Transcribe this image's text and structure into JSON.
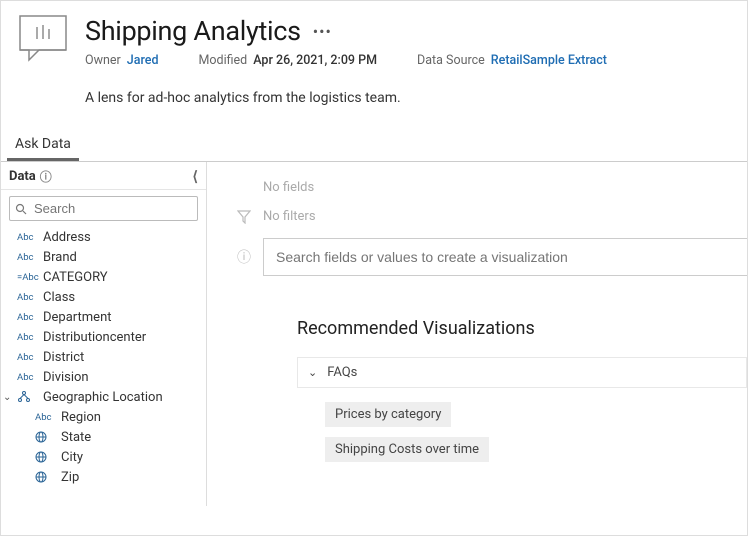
{
  "header": {
    "title": "Shipping Analytics",
    "owner_label": "Owner",
    "owner_name": "Jared",
    "modified_label": "Modified",
    "modified_value": "Apr 26, 2021, 2:09 PM",
    "datasource_label": "Data Source",
    "datasource_name": "RetailSample Extract",
    "description": "A lens for ad-hoc analytics from the logistics team."
  },
  "tab": {
    "label": "Ask Data"
  },
  "sidebar": {
    "data_label": "Data",
    "search_placeholder": "Search",
    "fields": [
      {
        "type": "Abc",
        "label": "Address"
      },
      {
        "type": "Abc",
        "label": "Brand"
      },
      {
        "type": "=Abc",
        "label": "CATEGORY"
      },
      {
        "type": "Abc",
        "label": "Class"
      },
      {
        "type": "Abc",
        "label": "Department"
      },
      {
        "type": "Abc",
        "label": "Distributioncenter"
      },
      {
        "type": "Abc",
        "label": "District"
      },
      {
        "type": "Abc",
        "label": "Division"
      }
    ],
    "geo": {
      "label": "Geographic Location",
      "children": [
        {
          "type": "Abc",
          "label": "Region"
        },
        {
          "type": "globe",
          "label": "State"
        },
        {
          "type": "globe",
          "label": "City"
        },
        {
          "type": "globe",
          "label": "Zip"
        }
      ]
    }
  },
  "main": {
    "no_fields": "No fields",
    "no_filters": "No filters",
    "search_placeholder": "Search fields or values to create a visualization",
    "rec_title": "Recommended Visualizations",
    "faq_label": "FAQs",
    "chips": [
      "Prices by category",
      "Shipping Costs over time"
    ]
  }
}
